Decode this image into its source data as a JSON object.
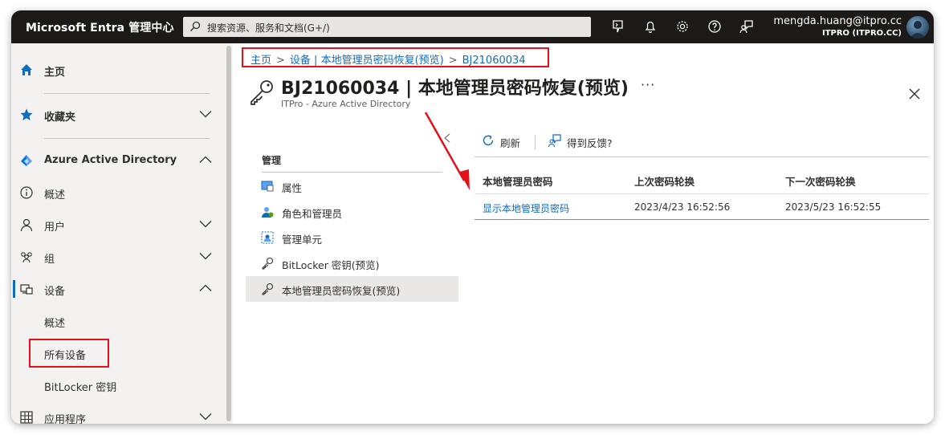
{
  "topbar": {
    "brand": "Microsoft Entra 管理中心",
    "search_placeholder": "搜索资源、服务和文档(G+/)",
    "user_name": "mengda.huang@itpro.cc",
    "user_tenant": "ITPRO (ITPRO.CC)",
    "icons": [
      "cloud-shell-icon",
      "bell-icon",
      "gear-icon",
      "help-icon",
      "feedback-icon"
    ]
  },
  "leftnav": {
    "home": "主页",
    "favorites": "收藏夹",
    "aad": "Azure Active Directory",
    "overview": "概述",
    "users": "用户",
    "groups": "组",
    "devices": "设备",
    "devices_overview": "概述",
    "all_devices": "所有设备",
    "bitlocker": "BitLocker 密钥",
    "apps": "应用程序"
  },
  "breadcrumb": {
    "home": "主页",
    "parent": "设备 | 本地管理员密码恢复(预览)",
    "current": "BJ21060034"
  },
  "page": {
    "title": "BJ21060034 | 本地管理员密码恢复(预览)",
    "subtitle": "ITPro - Azure Active Directory",
    "more": "···"
  },
  "menu": {
    "section": "管理",
    "items": [
      {
        "label": "属性"
      },
      {
        "label": "角色和管理员"
      },
      {
        "label": "管理单元"
      },
      {
        "label": "BitLocker 密钥(预览)"
      },
      {
        "label": "本地管理员密码恢复(预览)"
      }
    ]
  },
  "toolbar": {
    "refresh": "刷新",
    "feedback": "得到反馈?"
  },
  "table": {
    "headers": [
      "本地管理员密码",
      "上次密码轮换",
      "下一次密码轮换"
    ],
    "rows": [
      [
        "显示本地管理员密码",
        "2023/4/23 16:52:56",
        "2023/5/23 16:52:55"
      ]
    ]
  },
  "colors": {
    "accent": "#0f6cbd",
    "highlight": "#e3121a",
    "topbar": "#1b1a19"
  }
}
